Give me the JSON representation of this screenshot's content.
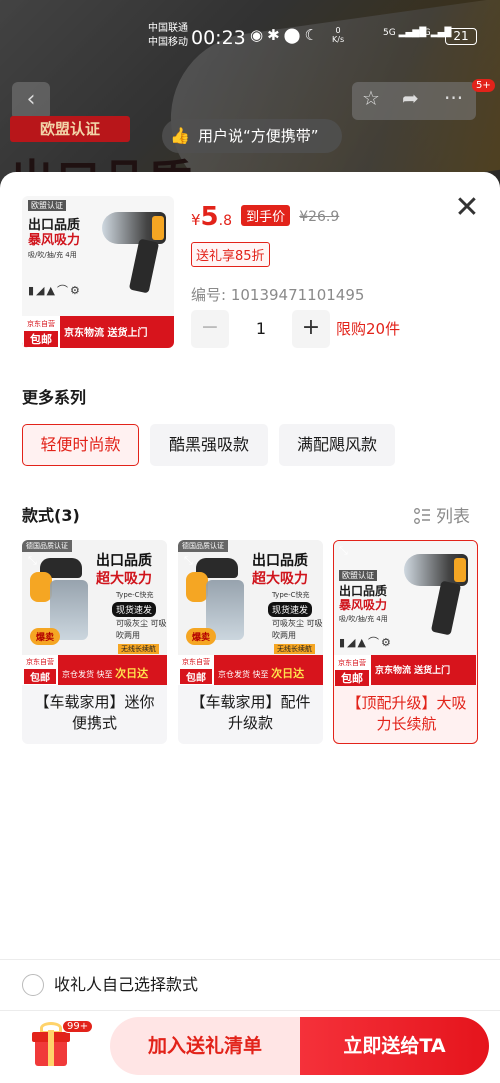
{
  "status_bar": {
    "carrier1": "中国联通",
    "carrier2": "中国移动",
    "time": "00:23",
    "speed_value": "0",
    "speed_unit": "K/s",
    "net1": "5G",
    "net2": "4G",
    "battery": "21"
  },
  "background": {
    "cert_tag": "欧盟认证",
    "review_text": "用户说“方便携带”",
    "big_text": "出口品质",
    "nav_badge": "5+"
  },
  "product": {
    "price_currency": "¥",
    "price_int": "5",
    "price_dec": ".8",
    "hand_price_label": "到手价",
    "original_price": "¥26.9",
    "gift_discount": "送礼享85折",
    "code_text": "编号: 10139471101495",
    "quantity": "1",
    "limit_text": "限购20件",
    "image": {
      "tag": "欧盟认证",
      "line1": "出口品质",
      "line2": "暴风吸力",
      "sub": "吸/吹/抽/充 4用",
      "brand_top": "京东自营",
      "brand_bottom": "包邮",
      "slogan": "京东物流 送货上门"
    }
  },
  "series": {
    "title": "更多系列",
    "items": [
      {
        "label": "轻便时尚款",
        "selected": true
      },
      {
        "label": "酷黑强吸款",
        "selected": false
      },
      {
        "label": "满配飓风款",
        "selected": false
      }
    ]
  },
  "styles": {
    "title": "款式(3)",
    "list_toggle": "列表",
    "items": [
      {
        "label": "【车载家用】迷你便携式",
        "selected": false,
        "img": {
          "tag": "德国品质认证",
          "h1": "出口品质",
          "h2": "超大吸力",
          "tc": "Type-C快充",
          "spot": "现货速发",
          "hot": "爆卖",
          "lines": "可吸灰尘 可吸吹两用",
          "wireless": "无线长续航",
          "brand_top": "京东自营",
          "brand_bottom": "包邮",
          "ship": "京仓发货 快至",
          "ship_hl": "次日达"
        }
      },
      {
        "label": "【车载家用】配件升级款",
        "selected": false,
        "img": {
          "tag": "德国品质认证",
          "h1": "出口品质",
          "h2": "超大吸力",
          "tc": "Type-C快充",
          "spot": "现货速发",
          "hot": "爆卖",
          "lines": "可吸灰尘 可吸吹两用",
          "wireless": "无线长续航",
          "brand_top": "京东自营",
          "brand_bottom": "包邮",
          "ship": "京仓发货 快至",
          "ship_hl": "次日达"
        }
      },
      {
        "label": "【顶配升级】大吸力长续航",
        "selected": true,
        "img": {
          "tag": "欧盟认证",
          "line1": "出口品质",
          "line2": "暴风吸力",
          "sub": "吸/吹/抽/充 4用",
          "brand_top": "京东自营",
          "brand_bottom": "包邮",
          "slogan": "京东物流 送货上门"
        }
      }
    ]
  },
  "recipient_choice": "收礼人自己选择款式",
  "bottom": {
    "gift_count": "99+",
    "add_label": "加入送礼清单",
    "send_label": "立即送给TA"
  },
  "colors": {
    "accent": "#e2231a",
    "dim_overlay": "rgba(0,0,0,0.45)"
  }
}
